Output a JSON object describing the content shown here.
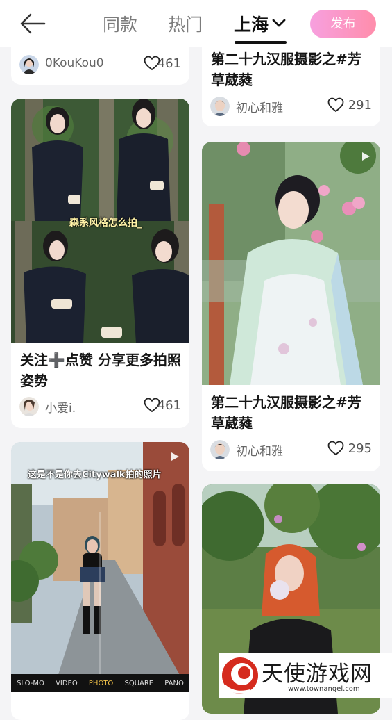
{
  "header": {
    "tabs": [
      {
        "label": "同款"
      },
      {
        "label": "热门"
      },
      {
        "label": "上海"
      }
    ],
    "publish_label": "发布"
  },
  "feed": {
    "left": [
      {
        "author": "0KouKou0",
        "likes": "461"
      },
      {
        "image_overlay": "森系风格怎么拍_",
        "title": "关注➕点赞 分享更多拍照姿势",
        "author": "小爱i.",
        "likes": "461"
      },
      {
        "image_overlay": "这是不是你去Citywalk拍的照片",
        "camera_modes": [
          "SLO-MO",
          "VIDEO",
          "PHOTO",
          "SQUARE",
          "PANO"
        ]
      }
    ],
    "right": [
      {
        "title": "第二十九汉服摄影之#芳草葳蕤",
        "author": "初心和雅",
        "likes": "291"
      },
      {
        "title": "第二十九汉服摄影之#芳草葳蕤",
        "author": "初心和雅",
        "likes": "295"
      },
      {}
    ]
  },
  "watermark": {
    "text": "天使游戏网",
    "url": "www.townangel.com"
  },
  "colors": {
    "accent_gradient_start": "#f7a0df",
    "accent_gradient_end": "#ff8dab"
  }
}
